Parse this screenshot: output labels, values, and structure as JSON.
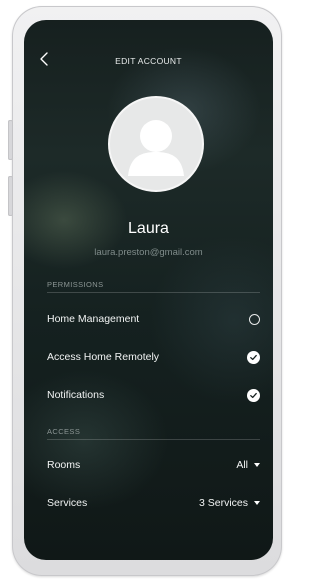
{
  "header": {
    "title": "EDIT ACCOUNT"
  },
  "profile": {
    "name": "Laura",
    "email": "laura.preston@gmail.com"
  },
  "permissions": {
    "label": "PERMISSIONS",
    "items": [
      {
        "label": "Home Management",
        "checked": false
      },
      {
        "label": "Access Home Remotely",
        "checked": true
      },
      {
        "label": "Notifications",
        "checked": true
      }
    ]
  },
  "access": {
    "label": "ACCESS",
    "rooms": {
      "label": "Rooms",
      "value": "All"
    },
    "services": {
      "label": "Services",
      "value": "3 Services"
    }
  },
  "icons": {
    "back": "chevron-left-icon",
    "avatar": "user-silhouette-icon",
    "check": "checkmark-icon",
    "caret": "caret-down-icon"
  }
}
